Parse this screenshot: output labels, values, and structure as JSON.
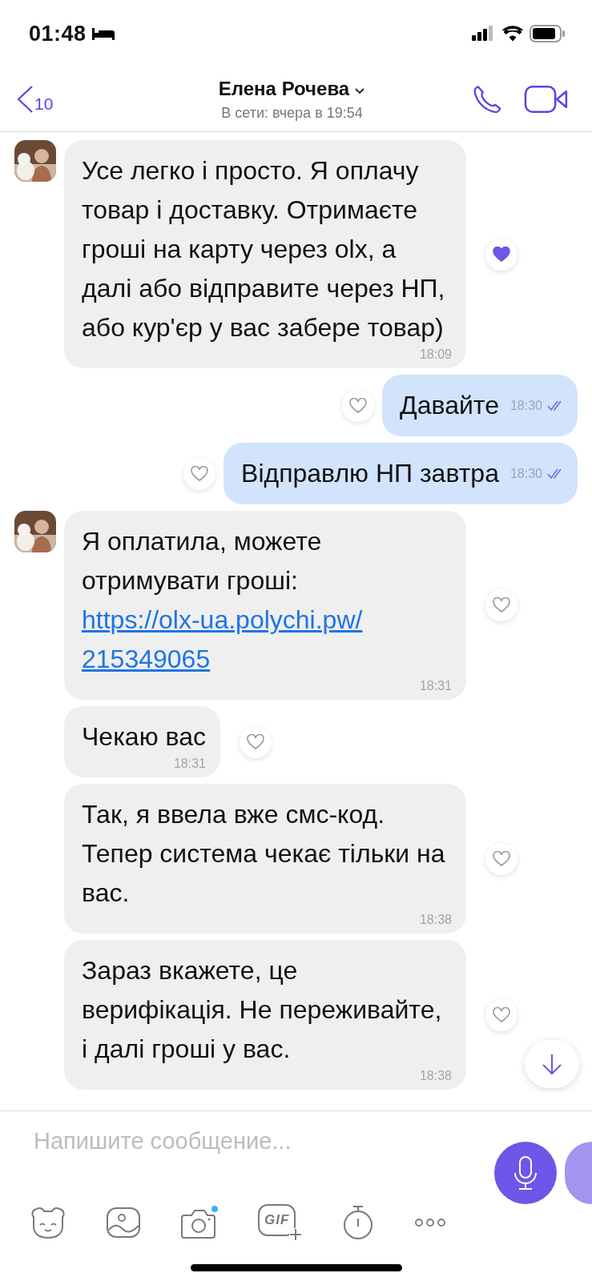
{
  "status_bar": {
    "time": "01:48"
  },
  "header": {
    "back_count": "10",
    "contact_name": "Елена Рочева",
    "presence": "В сети: вчера в 19:54"
  },
  "messages": [
    {
      "kind": "incoming",
      "avatar": true,
      "text": "Усе легко і просто. Я оплачу товар і доставку. Отримаєте гроші на карту через olx, а далі або відправите через НП, або кур'єр у вас забере товар)",
      "time": "18:09",
      "liked": true
    },
    {
      "kind": "outgoing",
      "text": "Давайте",
      "time": "18:30",
      "liked": false,
      "read": true
    },
    {
      "kind": "outgoing",
      "text": "Відправлю НП завтра",
      "time": "18:30",
      "liked": false,
      "read": true
    },
    {
      "kind": "incoming",
      "avatar": true,
      "text": "Я оплатила, можете отримувати гроші:",
      "link": "https://olx-ua.polychi.pw/215349065",
      "time": "18:31",
      "liked": false
    },
    {
      "kind": "incoming",
      "avatar": false,
      "text": "Чекаю вас",
      "time": "18:31",
      "liked": false
    },
    {
      "kind": "incoming",
      "avatar": false,
      "text": "Так, я ввела вже смс-код. Тепер система чекає тільки на вас.",
      "time": "18:38",
      "liked": false
    },
    {
      "kind": "incoming",
      "avatar": false,
      "text": "Зараз вкажете, це верифікація. Не переживайте, і далі гроші у вас.",
      "time": "18:38",
      "liked": false
    }
  ],
  "composer": {
    "placeholder": "Напишите сообщение..."
  },
  "toolbar": [
    {
      "kind": "sticker"
    },
    {
      "kind": "gallery"
    },
    {
      "kind": "camera",
      "badge": true
    },
    {
      "kind": "gif",
      "label": "GIF"
    },
    {
      "kind": "timer"
    },
    {
      "kind": "more"
    }
  ]
}
